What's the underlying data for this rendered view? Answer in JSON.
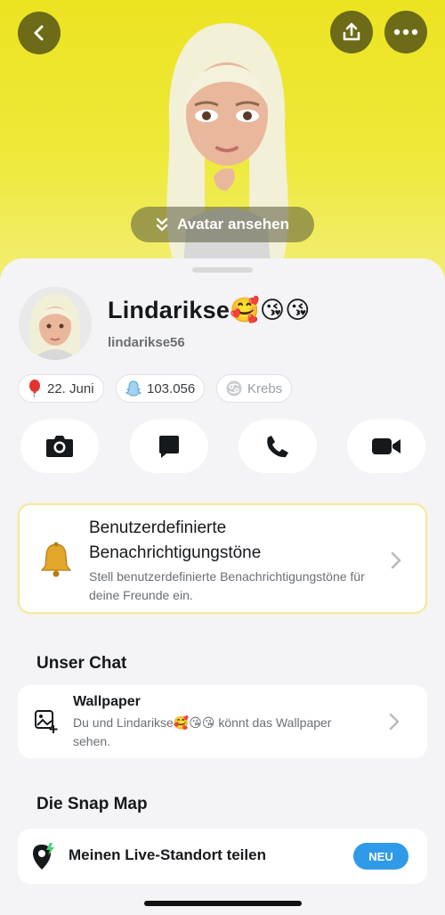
{
  "header": {
    "view_avatar_label": "Avatar ansehen"
  },
  "profile": {
    "display_name": "Lindarikse🥰😘😘",
    "username": "lindarikse56"
  },
  "chips": [
    {
      "icon": "balloon-icon",
      "label": "22. Juni"
    },
    {
      "icon": "snap-score-ghost-icon",
      "label": "103.056"
    },
    {
      "icon": "zodiac-cancer-icon",
      "label": "Krebs"
    }
  ],
  "actions": [
    {
      "icon": "camera-icon"
    },
    {
      "icon": "chat-icon"
    },
    {
      "icon": "phone-icon"
    },
    {
      "icon": "video-icon"
    }
  ],
  "notification_card": {
    "title": "Benutzerdefinierte Benachrichtigungstöne",
    "subtitle": "Stell benutzerdefinierte Benachrichtigungstöne für deine Freunde ein.",
    "icon": "bell-icon"
  },
  "chat_section": {
    "title": "Unser Chat",
    "wallpaper_title": "Wallpaper",
    "wallpaper_subtitle": "Du und Lindarikse🥰😘😘 könnt das Wallpaper sehen."
  },
  "map_section": {
    "title": "Die Snap Map",
    "live_location_label": "Meinen Live-Standort teilen",
    "badge": "NEU"
  },
  "colors": {
    "hero_yellow": "#ece321",
    "badge_blue": "#2f9be8",
    "card_gold_border": "#f4e7a3"
  }
}
